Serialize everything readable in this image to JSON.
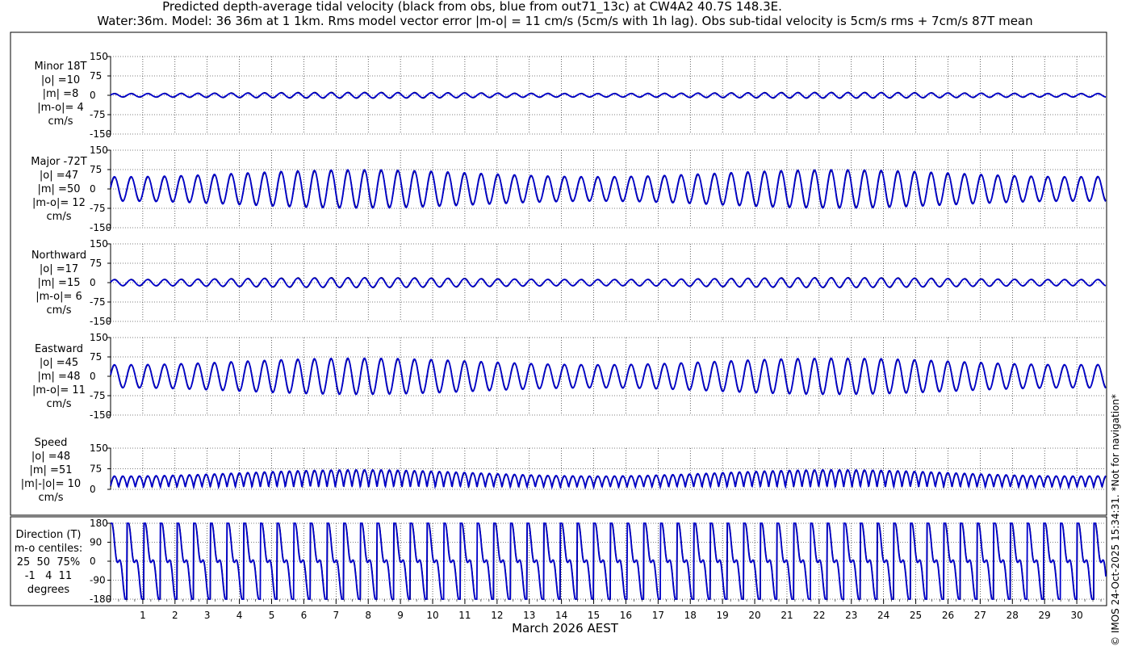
{
  "header": {
    "title_line1": "Predicted depth-average tidal velocity (black from obs, blue from out71_13c) at CW4A2 40.7S 148.3E.",
    "title_line2": "Water:36m. Model: 36 36m at 1 1km. Rms model vector error |m-o| = 11 cm/s (5cm/s with 1h lag). Obs sub-tidal velocity is 5cm/s rms + 7cm/s 87T mean"
  },
  "credit": "© IMOS 24-Oct-2025 15:34:31. *Not for navigation*",
  "colors": {
    "obs": "#000000",
    "model": "#0000cc"
  },
  "chart_data": [
    {
      "type": "line",
      "panel_label": "Minor 18T\n|o| =10\n|m| =8\n|m-o|= 4\ncm/s",
      "ylim": [
        -150,
        150
      ],
      "yticks": [
        "150",
        "75",
        "0",
        "-75",
        "-150"
      ],
      "series": [
        {
          "color": "#000000",
          "amplitude": 12
        },
        {
          "color": "#0000cc",
          "amplitude": 10
        }
      ]
    },
    {
      "type": "line",
      "panel_label": "Major -72T\n|o| =47\n|m| =50\n|m-o|= 12\ncm/s",
      "ylim": [
        -150,
        150
      ],
      "yticks": [
        "150",
        "75",
        "0",
        "-75",
        "-150"
      ],
      "series": [
        {
          "color": "#000000",
          "amplitude": 70
        },
        {
          "color": "#0000cc",
          "amplitude": 74
        }
      ]
    },
    {
      "type": "line",
      "panel_label": "Northward\n|o| =17\n|m| =15\n|m-o|= 6\ncm/s",
      "ylim": [
        -150,
        150
      ],
      "yticks": [
        "150",
        "75",
        "0",
        "-75",
        "-150"
      ],
      "series": [
        {
          "color": "#000000",
          "amplitude": 20
        },
        {
          "color": "#0000cc",
          "amplitude": 18
        }
      ]
    },
    {
      "type": "line",
      "panel_label": "Eastward\n|o| =45\n|m| =48\n|m-o|= 11\ncm/s",
      "ylim": [
        -150,
        150
      ],
      "yticks": [
        "150",
        "75",
        "0",
        "-75",
        "-150"
      ],
      "series": [
        {
          "color": "#000000",
          "amplitude": 67
        },
        {
          "color": "#0000cc",
          "amplitude": 70
        }
      ]
    },
    {
      "type": "line",
      "panel_label": "Speed\n|o| =48\n|m| =51\n|m|-|o|= 10\ncm/s",
      "ylim": [
        0,
        150
      ],
      "yticks": [
        "150",
        "75",
        "0"
      ],
      "series": [
        {
          "color": "#000000",
          "amplitude": 60
        },
        {
          "color": "#0000cc",
          "amplitude": 63
        }
      ]
    },
    {
      "type": "line",
      "panel_label": "Direction (T)\nm-o centiles:\n25  50  75%\n-1   4  11\ndegrees",
      "ylim": [
        -180,
        180
      ],
      "yticks": [
        "180",
        "90",
        "0",
        "-90",
        "-180"
      ],
      "series": [
        {
          "color": "#000000"
        },
        {
          "color": "#0000cc"
        }
      ]
    }
  ],
  "x_axis": {
    "label": "March 2026 AEST",
    "range": [
      0,
      30.9
    ],
    "ticks": [
      "1",
      "2",
      "3",
      "4",
      "5",
      "6",
      "7",
      "8",
      "9",
      "10",
      "11",
      "12",
      "13",
      "14",
      "15",
      "16",
      "17",
      "18",
      "19",
      "20",
      "21",
      "22",
      "23",
      "24",
      "25",
      "26",
      "27",
      "28",
      "29",
      "30"
    ]
  }
}
